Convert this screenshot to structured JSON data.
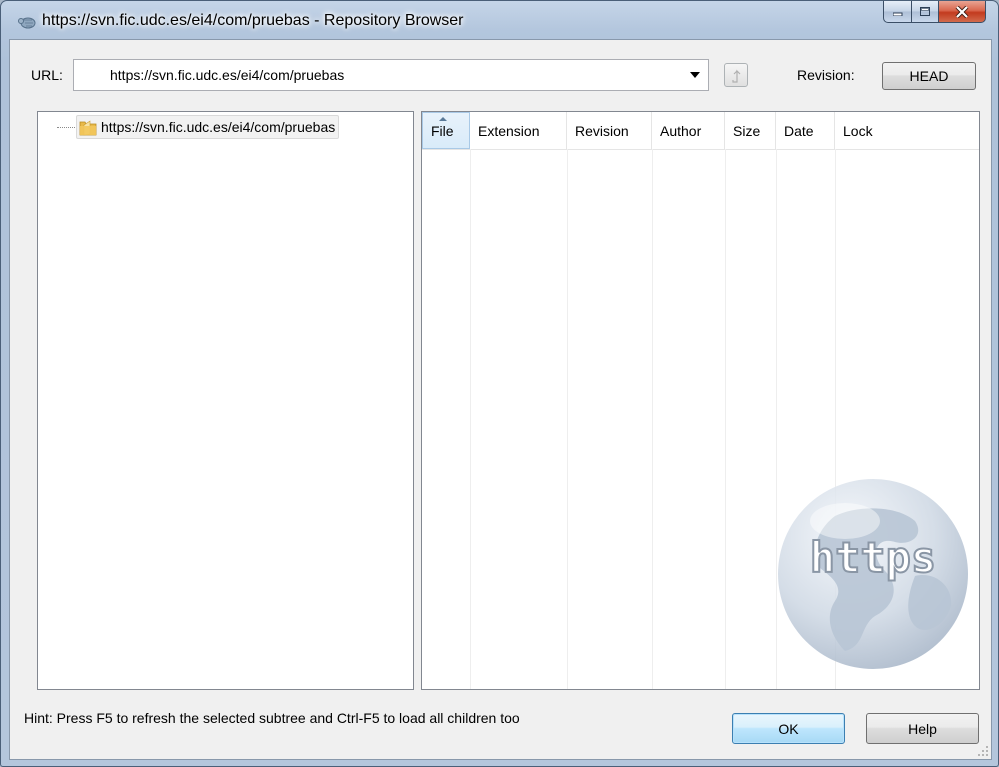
{
  "window": {
    "title": "https://svn.fic.udc.es/ei4/com/pruebas - Repository Browser"
  },
  "toolbar": {
    "url_label": "URL:",
    "url_value": "https://svn.fic.udc.es/ei4/com/pruebas",
    "revision_label": "Revision:",
    "revision_value": "HEAD"
  },
  "tree": {
    "items": [
      {
        "label": "https://svn.fic.udc.es/ei4/com/pruebas",
        "icon": "folder-icon",
        "selected": true
      }
    ]
  },
  "list": {
    "columns": [
      "File",
      "Extension",
      "Revision",
      "Author",
      "Size",
      "Date",
      "Lock"
    ],
    "sorted_column": "File",
    "rows": []
  },
  "watermark": {
    "text": "https"
  },
  "footer": {
    "hint": "Hint: Press F5 to refresh the selected subtree and Ctrl-F5 to load all children too",
    "ok_label": "OK",
    "help_label": "Help"
  },
  "colors": {
    "frame": "#b3c6dd",
    "close_button": "#c23a1e",
    "default_button_border": "#3c7fb1"
  }
}
